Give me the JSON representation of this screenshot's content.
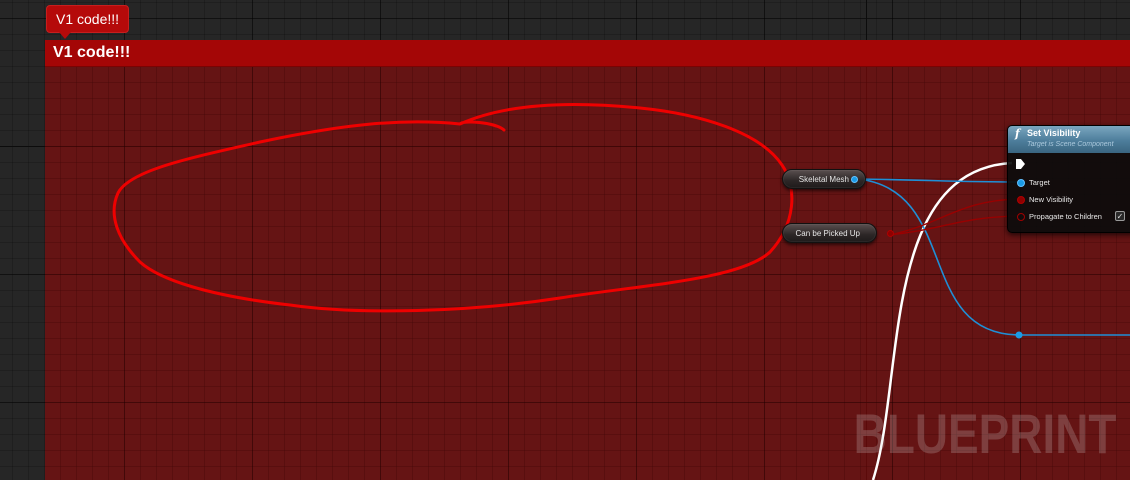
{
  "comment": {
    "bubble_text": "V1 code!!!",
    "header_title": "V1 code!!!",
    "color": "#a40606"
  },
  "variables": [
    {
      "label": "Skeletal Mesh",
      "pin_color": "#1a9be6",
      "pin_type": "object"
    },
    {
      "label": "Can be Picked Up",
      "pin_color": "#8e0000",
      "pin_type": "boolean"
    }
  ],
  "function_node": {
    "icon": "function-icon",
    "icon_glyph": "f",
    "title": "Set Visibility",
    "subtitle": "Target is Scene Component",
    "pins": [
      {
        "label": "Target",
        "type": "object"
      },
      {
        "label": "New Visibility",
        "type": "boolean"
      },
      {
        "label": "Propagate to Children",
        "type": "boolean",
        "checked": true
      }
    ]
  },
  "annotation": {
    "type": "freehand-circle",
    "color": "#ee0000"
  },
  "watermark": "BLUEPRINT"
}
